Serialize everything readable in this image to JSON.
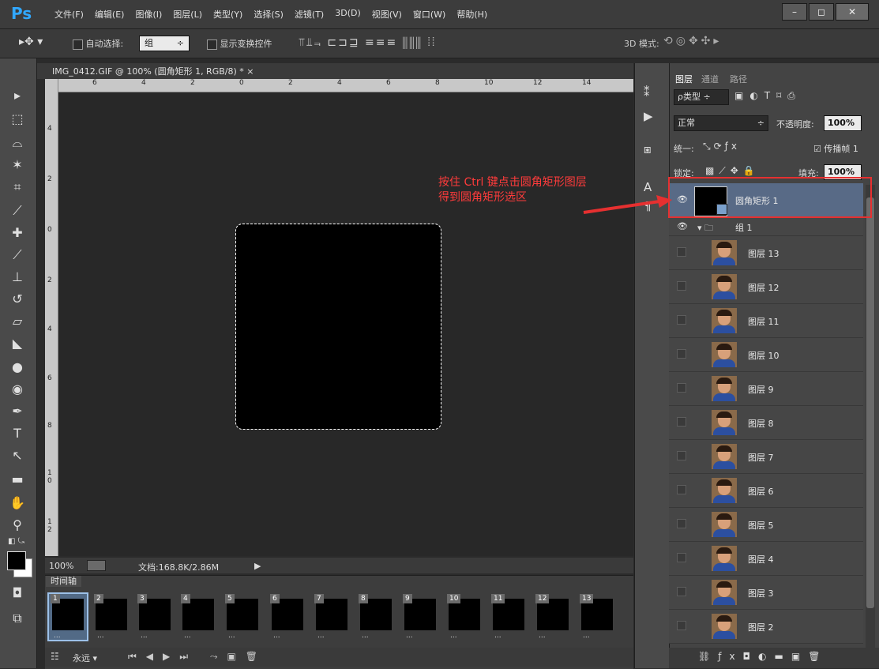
{
  "app": {
    "logo": "Ps",
    "menu": [
      "文件(F)",
      "编辑(E)",
      "图像(I)",
      "图层(L)",
      "类型(Y)",
      "选择(S)",
      "滤镜(T)",
      "3D(D)",
      "视图(V)",
      "窗口(W)",
      "帮助(H)"
    ],
    "window_buttons": [
      "–",
      "◻",
      "✕"
    ]
  },
  "options": {
    "auto_select_label": "自动选择:",
    "auto_select_value": "组",
    "show_transform_label": "显示变换控件",
    "mode3d_label": "3D 模式:"
  },
  "document": {
    "tab_title": "IMG_0412.GIF @ 100% (圆角矩形 1, RGB/8) *",
    "close": "×",
    "h_ruler": [
      "6",
      "4",
      "2",
      "0",
      "2",
      "4",
      "6",
      "8",
      "10",
      "12",
      "14"
    ],
    "v_ruler": [
      "4",
      "2",
      "0",
      "2",
      "4",
      "6",
      "8",
      "1 0",
      "1 2"
    ]
  },
  "status": {
    "zoom": "100%",
    "doc_info": "文档:168.8K/2.86M"
  },
  "timeline": {
    "title": "时间轴",
    "frames": [
      "1",
      "2",
      "3",
      "4",
      "5",
      "6",
      "7",
      "8",
      "9",
      "10",
      "11",
      "12",
      "13"
    ],
    "delay": "...",
    "loop": "永远"
  },
  "layers_panel": {
    "tabs": [
      "图层",
      "通道",
      "路径"
    ],
    "filter_kind": "ρ类型",
    "blend_mode": "正常",
    "opacity_label": "不透明度:",
    "opacity_value": "100%",
    "unify_label": "统一:",
    "propagate_label": "传播帧 1",
    "lock_label": "锁定:",
    "fill_label": "填充:",
    "fill_value": "100%",
    "selected_layer": "圆角矩形 1",
    "group_name": "组 1",
    "layers": [
      "图层 13",
      "图层 12",
      "图层 11",
      "图层 10",
      "图层 9",
      "图层 8",
      "图层 7",
      "图层 6",
      "图层 5",
      "图层 4",
      "图层 3",
      "图层 2"
    ]
  },
  "annotation": {
    "line1": "按住 Ctrl 键点击圆角矩形图层",
    "line2": "得到圆角矩形选区",
    "color": "#ff3b3b"
  }
}
